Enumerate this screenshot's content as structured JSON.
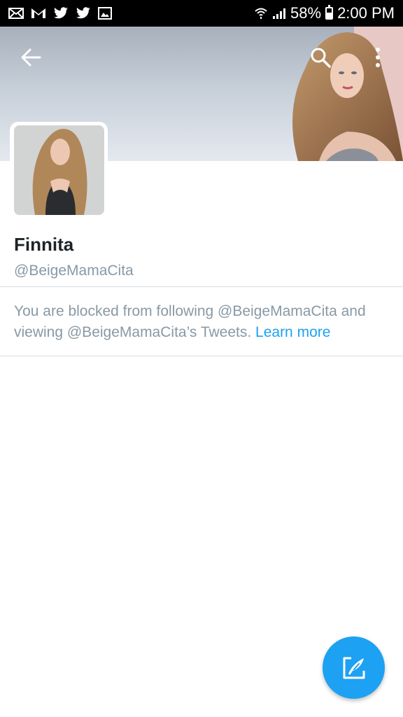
{
  "status_bar": {
    "battery_pct": "58%",
    "clock": "2:00 PM",
    "battery_level": 0.58,
    "left_icons": [
      "mail-icon",
      "gmail-icon",
      "twitter-icon",
      "twitter-icon",
      "gallery-icon"
    ],
    "right_icons": [
      "wifi-icon",
      "signal-icon",
      "battery-icon"
    ]
  },
  "header": {
    "icons": [
      "back-arrow-icon",
      "search-icon",
      "more-vertical-icon"
    ]
  },
  "profile": {
    "display_name": "Finnita",
    "handle": "@BeigeMamaCita"
  },
  "blocked": {
    "message": "You are blocked from following @BeigeMamaCita and viewing @BeigeMamaCita’s Tweets. ",
    "learn_more": "Learn more"
  },
  "fab": {
    "icon": "compose-tweet-icon",
    "color": "#1da1f2"
  },
  "colors": {
    "accent": "#1da1f2",
    "secondary_text": "#8899a6",
    "primary_text": "#1c2328"
  }
}
